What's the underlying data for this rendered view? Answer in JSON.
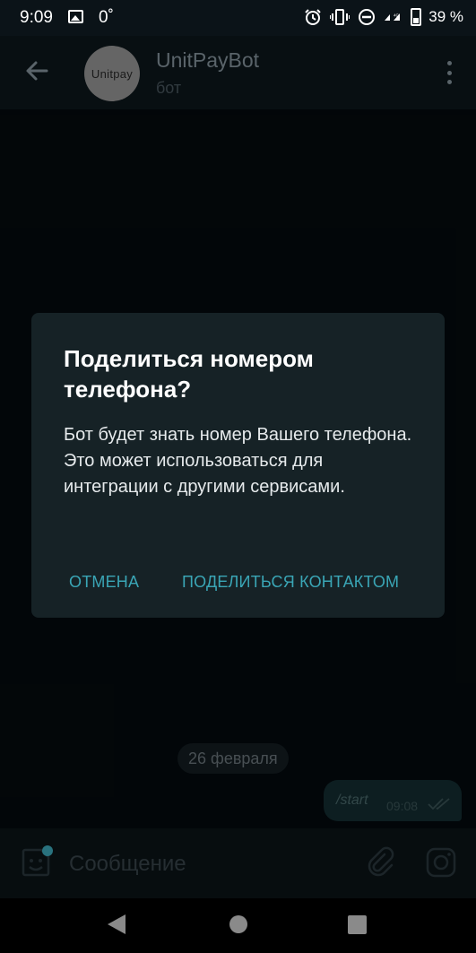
{
  "status_bar": {
    "time": "9:09",
    "temperature": "0˚",
    "network": "4G",
    "battery": "39 %"
  },
  "header": {
    "avatar_text": "Unitpay",
    "bot_name": "UnitPayBot",
    "bot_status": "бот"
  },
  "chat": {
    "date_label": "26 февраля",
    "message": {
      "text": "/start",
      "time": "09:08"
    }
  },
  "input": {
    "placeholder": "Сообщение"
  },
  "dialog": {
    "title": "Поделиться номером телефона?",
    "message": "Бот будет знать номер Вашего телефона. Это может использоваться для интеграции с другими сервисами.",
    "cancel_label": "ОТМЕНА",
    "share_label": "ПОДЕЛИТЬСЯ КОНТАКТОМ"
  },
  "colors": {
    "accent": "#3aa6b6",
    "dialog_bg": "#162226",
    "background": "#040a0e"
  },
  "icons": [
    "back-arrow-icon",
    "more-vert-icon",
    "sticker-icon",
    "attach-icon",
    "camera-icon",
    "nav-back-icon",
    "nav-home-icon",
    "nav-recent-icon",
    "alarm-icon",
    "vibrate-icon",
    "dnd-icon",
    "signal-icon",
    "battery-icon",
    "double-check-icon"
  ]
}
